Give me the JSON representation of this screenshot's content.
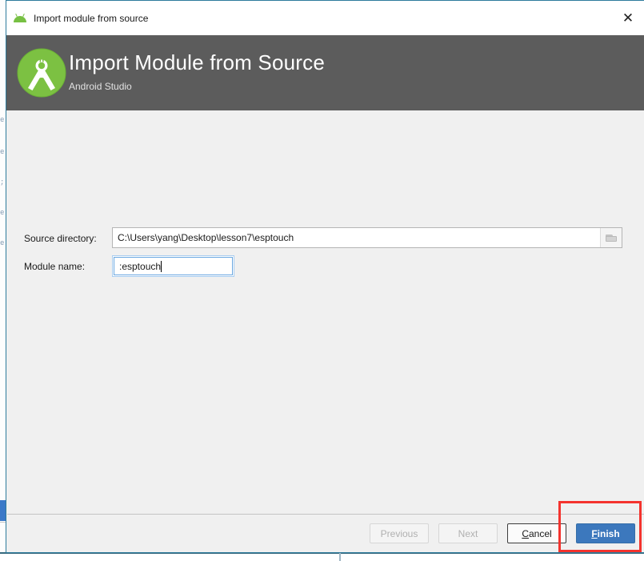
{
  "window": {
    "title": "Import module from source",
    "title_icon": "android-head-icon",
    "close_label": "✕"
  },
  "header": {
    "title": "Import Module from Source",
    "subtitle": "Android Studio",
    "logo_icon": "android-studio-logo",
    "background_color": "#5c5c5c"
  },
  "form": {
    "source_directory": {
      "label": "Source directory:",
      "value": "C:\\Users\\yang\\Desktop\\lesson7\\esptouch",
      "placeholder": "",
      "browse_icon": "folder-icon"
    },
    "module_name": {
      "label": "Module name:",
      "value": ":esptouch",
      "placeholder": "",
      "focused": true
    }
  },
  "footer": {
    "buttons": [
      {
        "label": "Previous",
        "state": "disabled",
        "style": "secondary"
      },
      {
        "label": "Next",
        "state": "disabled",
        "style": "secondary"
      },
      {
        "label": "Cancel",
        "state": "enabled",
        "style": "outlined",
        "mnemonic": "C"
      },
      {
        "label": "Finish",
        "state": "enabled",
        "style": "primary",
        "mnemonic": "F"
      }
    ]
  },
  "annotation": {
    "shape": "rectangle",
    "color": "#f4332e",
    "target": "Finish"
  },
  "backdrop": {
    "glyphs": [
      "e",
      "e",
      ";",
      "e",
      "e"
    ],
    "accent_color": "#3b79c8"
  }
}
